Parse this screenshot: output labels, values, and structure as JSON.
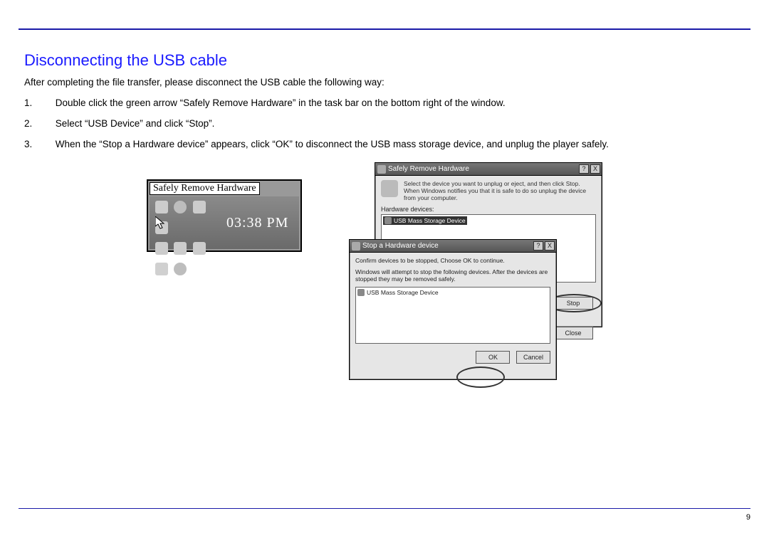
{
  "heading": "Disconnecting the USB cable",
  "intro": "After completing the file transfer, please disconnect the USB cable the following way:",
  "steps": [
    {
      "n": "1.",
      "t": "Double click the green arrow “Safely Remove Hardware” in the task bar on the bottom right of the window."
    },
    {
      "n": "2.",
      "t": "Select “USB Device” and click “Stop”."
    },
    {
      "n": "3.",
      "t": "When the “Stop a Hardware device” appears, click “OK” to disconnect the USB mass storage device, and unplug the player safely."
    }
  ],
  "taskbar": {
    "tooltip": "Safely Remove Hardware",
    "clock": "03:38 PM"
  },
  "srh": {
    "title": "Safely Remove Hardware",
    "desc": "Select the device you want to unplug or eject, and then click Stop. When Windows notifies you that it is safe to do so unplug the device from your computer.",
    "list_label": "Hardware devices:",
    "list_item": "USB Mass Storage Device",
    "btn_stop": "Stop",
    "btn_close": "Close"
  },
  "shd": {
    "title": "Stop a Hardware device",
    "line1": "Confirm devices to be stopped, Choose OK to continue.",
    "line2": "Windows will attempt to stop the following devices. After the devices are stopped they may be removed safely.",
    "list_item": "USB Mass Storage Device",
    "btn_ok": "OK",
    "btn_cancel": "Cancel"
  },
  "titlebar_help": "?",
  "titlebar_close": "X",
  "page_number": "9"
}
